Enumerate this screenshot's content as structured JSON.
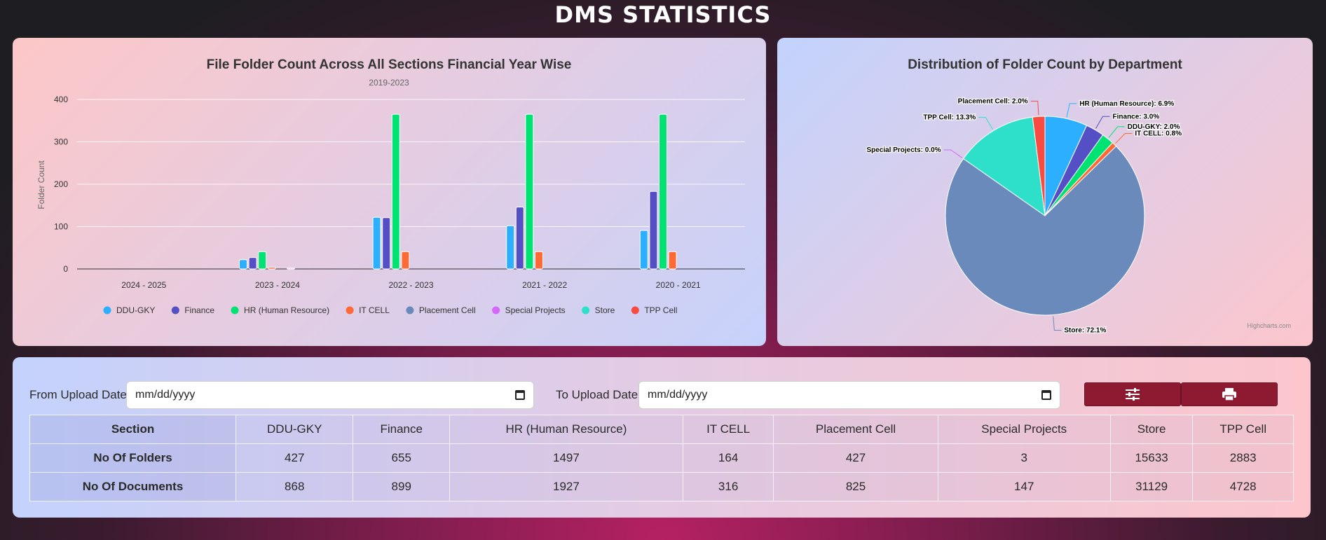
{
  "page": {
    "title": "DMS STATISTICS"
  },
  "bar_chart": {
    "title": "File Folder Count Across All Sections Financial Year Wise",
    "subtitle": "2019-2023",
    "ylabel": "Folder Count",
    "yticks": [
      "400",
      "300",
      "200",
      "100",
      "0"
    ]
  },
  "pie_chart": {
    "title": "Distribution of Folder Count by Department",
    "credit": "Highcharts.com"
  },
  "chart_data": [
    {
      "type": "bar",
      "title": "File Folder Count Across All Sections Financial Year Wise",
      "subtitle": "2019-2023",
      "xlabel": "",
      "ylabel": "Folder Count",
      "ylim": [
        0,
        400
      ],
      "grid": true,
      "legend": "bottom",
      "categories": [
        "2024 - 2025",
        "2023 - 2024",
        "2022 - 2023",
        "2021 - 2022",
        "2020 - 2021"
      ],
      "series": [
        {
          "name": "DDU-GKY",
          "color": "#2caffe",
          "values": [
            0,
            22,
            122,
            102,
            91
          ]
        },
        {
          "name": "Finance",
          "color": "#544fc5",
          "values": [
            0,
            27,
            121,
            146,
            183
          ]
        },
        {
          "name": "HR (Human Resource)",
          "color": "#00e272",
          "values": [
            0,
            41,
            365,
            365,
            365
          ]
        },
        {
          "name": "IT CELL",
          "color": "#fe6a35",
          "values": [
            0,
            4,
            41,
            41,
            41
          ]
        },
        {
          "name": "Placement Cell",
          "color": "#6b8abc",
          "values": [
            0,
            0,
            0,
            0,
            0
          ]
        },
        {
          "name": "Special Projects",
          "color": "#d568fb",
          "values": [
            0,
            2,
            0,
            0,
            0
          ]
        },
        {
          "name": "Store",
          "color": "#2ee0ca",
          "values": [
            0,
            0,
            0,
            0,
            0
          ]
        },
        {
          "name": "TPP Cell",
          "color": "#fa4b42",
          "values": [
            0,
            0,
            0,
            0,
            0
          ]
        }
      ]
    },
    {
      "type": "pie",
      "title": "Distribution of Folder Count by Department",
      "slices": [
        {
          "name": "HR (Human Resource)",
          "label": "HR (Human Resource): 6.9%",
          "value": 6.9,
          "color": "#2caffe"
        },
        {
          "name": "Finance",
          "label": "Finance: 3.0%",
          "value": 3.0,
          "color": "#544fc5"
        },
        {
          "name": "DDU-GKY",
          "label": "DDU-GKY: 2.0%",
          "value": 2.0,
          "color": "#00e272"
        },
        {
          "name": "IT CELL",
          "label": "IT CELL: 0.8%",
          "value": 0.8,
          "color": "#fe6a35"
        },
        {
          "name": "Store",
          "label": "Store: 72.1%",
          "value": 72.1,
          "color": "#6b8abc"
        },
        {
          "name": "Special Projects",
          "label": "Special Projects: 0.0%",
          "value": 0.0,
          "color": "#d568fb"
        },
        {
          "name": "TPP Cell",
          "label": "TPP Cell: 13.3%",
          "value": 13.3,
          "color": "#2ee0ca"
        },
        {
          "name": "Placement Cell",
          "label": "Placement Cell: 2.0%",
          "value": 2.0,
          "color": "#fa4b42"
        }
      ]
    }
  ],
  "filters": {
    "from_label": "From Upload Date",
    "from_value": "mm/dd/yyyy",
    "to_label": "To Upload Date",
    "to_value": "mm/dd/yyyy",
    "filter_icon": "sliders-icon",
    "print_icon": "print-icon"
  },
  "table": {
    "headers": [
      "Section",
      "DDU-GKY",
      "Finance",
      "HR (Human Resource)",
      "IT CELL",
      "Placement Cell",
      "Special Projects",
      "Store",
      "TPP Cell"
    ],
    "rows": [
      {
        "label": "No Of Folders",
        "cells": [
          "427",
          "655",
          "1497",
          "164",
          "427",
          "3",
          "15633",
          "2883"
        ]
      },
      {
        "label": "No Of Documents",
        "cells": [
          "868",
          "899",
          "1927",
          "316",
          "825",
          "147",
          "31129",
          "4728"
        ]
      }
    ]
  }
}
